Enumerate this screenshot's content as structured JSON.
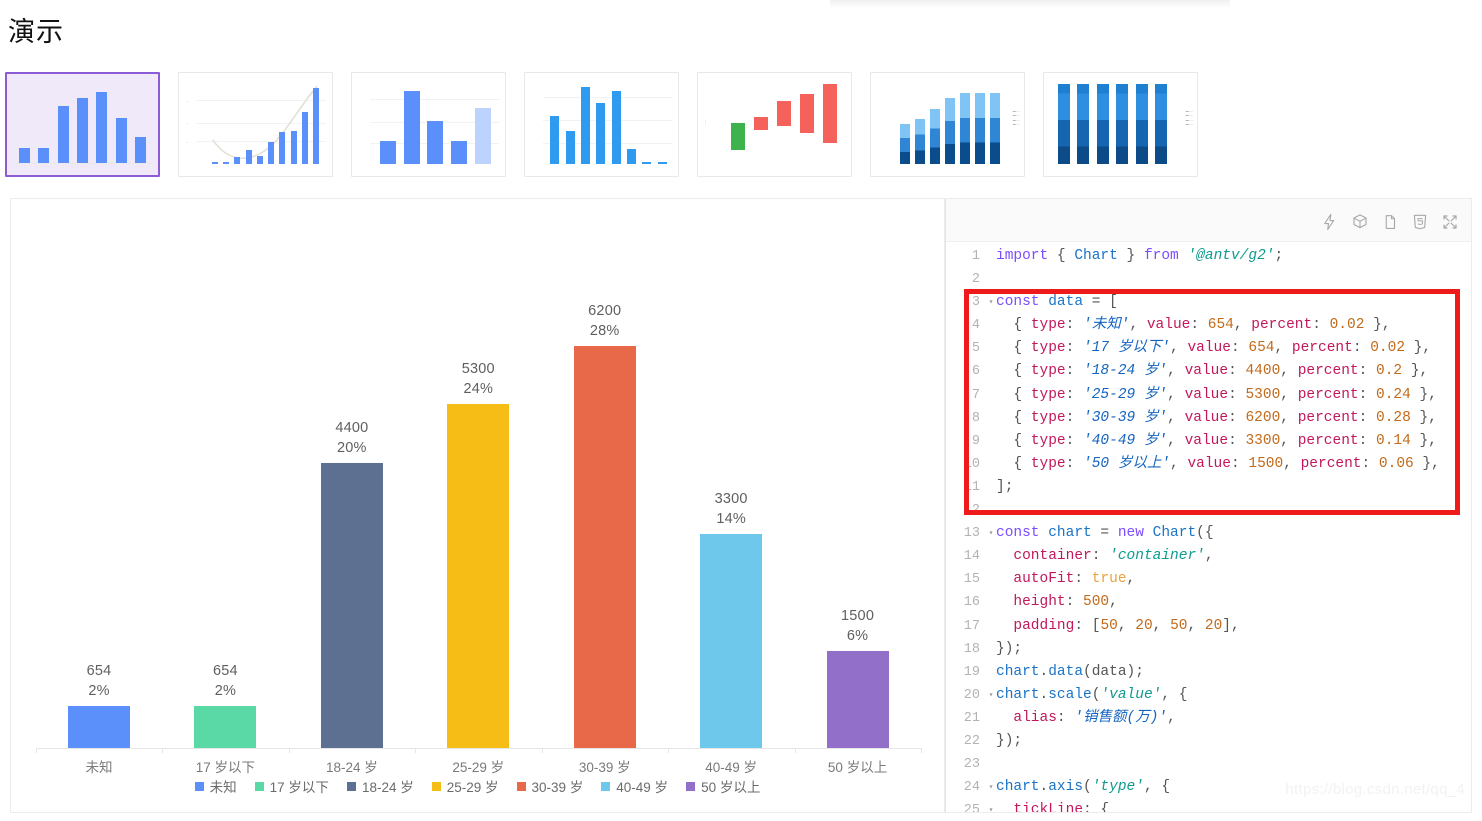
{
  "header": {
    "title": "演示"
  },
  "thumbnails": [
    {
      "name": "basic-column-chart",
      "selected": true
    },
    {
      "name": "column-with-line-chart",
      "selected": false
    },
    {
      "name": "column-highlight-chart",
      "selected": false
    },
    {
      "name": "grouped-column-chart",
      "selected": false
    },
    {
      "name": "waterfall-chart",
      "selected": false
    },
    {
      "name": "stacked-column-chart",
      "selected": false
    },
    {
      "name": "percent-stacked-column-chart",
      "selected": false
    }
  ],
  "chart_data": {
    "type": "bar",
    "title": "",
    "xlabel": "",
    "ylabel": "销售额(万)",
    "categories": [
      "未知",
      "17 岁以下",
      "18-24 岁",
      "25-29 岁",
      "30-39 岁",
      "40-49 岁",
      "50 岁以上"
    ],
    "values": [
      654,
      654,
      4400,
      5300,
      6200,
      3300,
      1500
    ],
    "percents": [
      "2%",
      "2%",
      "20%",
      "24%",
      "28%",
      "14%",
      "6%"
    ],
    "percent_values": [
      0.02,
      0.02,
      0.2,
      0.24,
      0.28,
      0.14,
      0.06
    ],
    "value_labels": [
      "654",
      "654",
      "4400",
      "5300",
      "6200",
      "3300",
      "1500"
    ],
    "colors": [
      "#5B8FF9",
      "#5AD8A6",
      "#5D7092",
      "#F6BD16",
      "#E8684A",
      "#6DC8EC",
      "#9270CA"
    ],
    "ylim": [
      0,
      6200
    ],
    "grid": false,
    "legend_position": "bottom",
    "legend": [
      "未知",
      "17 岁以下",
      "18-24 岁",
      "25-29 岁",
      "30-39 岁",
      "40-49 岁",
      "50 岁以上"
    ]
  },
  "code_panel": {
    "toolbar": [
      {
        "icon": "lightning-icon"
      },
      {
        "icon": "codesandbox-cube-icon"
      },
      {
        "icon": "copy-file-icon"
      },
      {
        "icon": "html5-badge-icon"
      },
      {
        "icon": "fullscreen-icon"
      }
    ],
    "lines": [
      {
        "n": "1",
        "fold": "",
        "tokens": [
          {
            "t": "import",
            "c": "kw"
          },
          {
            "t": " { ",
            "c": "pl"
          },
          {
            "t": "Chart",
            "c": "var"
          },
          {
            "t": " } ",
            "c": "pl"
          },
          {
            "t": "from",
            "c": "kw"
          },
          {
            "t": " ",
            "c": "pl"
          },
          {
            "t": "'@antv/g2'",
            "c": "str"
          },
          {
            "t": ";",
            "c": "pl"
          }
        ]
      },
      {
        "n": "2",
        "fold": "",
        "tokens": []
      },
      {
        "n": "3",
        "fold": "▾",
        "tokens": [
          {
            "t": "const",
            "c": "kw"
          },
          {
            "t": " ",
            "c": "pl"
          },
          {
            "t": "data",
            "c": "var"
          },
          {
            "t": " = [",
            "c": "pl"
          }
        ]
      },
      {
        "n": "4",
        "fold": "",
        "tokens": [
          {
            "t": "  { ",
            "c": "pl"
          },
          {
            "t": "type",
            "c": "prop"
          },
          {
            "t": ": ",
            "c": "pl"
          },
          {
            "t": "'未知'",
            "c": "strb"
          },
          {
            "t": ", ",
            "c": "pl"
          },
          {
            "t": "value",
            "c": "prop"
          },
          {
            "t": ": ",
            "c": "pl"
          },
          {
            "t": "654",
            "c": "num"
          },
          {
            "t": ", ",
            "c": "pl"
          },
          {
            "t": "percent",
            "c": "prop"
          },
          {
            "t": ": ",
            "c": "pl"
          },
          {
            "t": "0.02",
            "c": "num"
          },
          {
            "t": " },",
            "c": "pl"
          }
        ]
      },
      {
        "n": "5",
        "fold": "",
        "tokens": [
          {
            "t": "  { ",
            "c": "pl"
          },
          {
            "t": "type",
            "c": "prop"
          },
          {
            "t": ": ",
            "c": "pl"
          },
          {
            "t": "'17 岁以下'",
            "c": "strb"
          },
          {
            "t": ", ",
            "c": "pl"
          },
          {
            "t": "value",
            "c": "prop"
          },
          {
            "t": ": ",
            "c": "pl"
          },
          {
            "t": "654",
            "c": "num"
          },
          {
            "t": ", ",
            "c": "pl"
          },
          {
            "t": "percent",
            "c": "prop"
          },
          {
            "t": ": ",
            "c": "pl"
          },
          {
            "t": "0.02",
            "c": "num"
          },
          {
            "t": " },",
            "c": "pl"
          }
        ]
      },
      {
        "n": "6",
        "fold": "",
        "tokens": [
          {
            "t": "  { ",
            "c": "pl"
          },
          {
            "t": "type",
            "c": "prop"
          },
          {
            "t": ": ",
            "c": "pl"
          },
          {
            "t": "'18-24 岁'",
            "c": "strb"
          },
          {
            "t": ", ",
            "c": "pl"
          },
          {
            "t": "value",
            "c": "prop"
          },
          {
            "t": ": ",
            "c": "pl"
          },
          {
            "t": "4400",
            "c": "num"
          },
          {
            "t": ", ",
            "c": "pl"
          },
          {
            "t": "percent",
            "c": "prop"
          },
          {
            "t": ": ",
            "c": "pl"
          },
          {
            "t": "0.2",
            "c": "num"
          },
          {
            "t": " },",
            "c": "pl"
          }
        ]
      },
      {
        "n": "7",
        "fold": "",
        "tokens": [
          {
            "t": "  { ",
            "c": "pl"
          },
          {
            "t": "type",
            "c": "prop"
          },
          {
            "t": ": ",
            "c": "pl"
          },
          {
            "t": "'25-29 岁'",
            "c": "strb"
          },
          {
            "t": ", ",
            "c": "pl"
          },
          {
            "t": "value",
            "c": "prop"
          },
          {
            "t": ": ",
            "c": "pl"
          },
          {
            "t": "5300",
            "c": "num"
          },
          {
            "t": ", ",
            "c": "pl"
          },
          {
            "t": "percent",
            "c": "prop"
          },
          {
            "t": ": ",
            "c": "pl"
          },
          {
            "t": "0.24",
            "c": "num"
          },
          {
            "t": " },",
            "c": "pl"
          }
        ]
      },
      {
        "n": "8",
        "fold": "",
        "tokens": [
          {
            "t": "  { ",
            "c": "pl"
          },
          {
            "t": "type",
            "c": "prop"
          },
          {
            "t": ": ",
            "c": "pl"
          },
          {
            "t": "'30-39 岁'",
            "c": "strb"
          },
          {
            "t": ", ",
            "c": "pl"
          },
          {
            "t": "value",
            "c": "prop"
          },
          {
            "t": ": ",
            "c": "pl"
          },
          {
            "t": "6200",
            "c": "num"
          },
          {
            "t": ", ",
            "c": "pl"
          },
          {
            "t": "percent",
            "c": "prop"
          },
          {
            "t": ": ",
            "c": "pl"
          },
          {
            "t": "0.28",
            "c": "num"
          },
          {
            "t": " },",
            "c": "pl"
          }
        ]
      },
      {
        "n": "9",
        "fold": "",
        "tokens": [
          {
            "t": "  { ",
            "c": "pl"
          },
          {
            "t": "type",
            "c": "prop"
          },
          {
            "t": ": ",
            "c": "pl"
          },
          {
            "t": "'40-49 岁'",
            "c": "strb"
          },
          {
            "t": ", ",
            "c": "pl"
          },
          {
            "t": "value",
            "c": "prop"
          },
          {
            "t": ": ",
            "c": "pl"
          },
          {
            "t": "3300",
            "c": "num"
          },
          {
            "t": ", ",
            "c": "pl"
          },
          {
            "t": "percent",
            "c": "prop"
          },
          {
            "t": ": ",
            "c": "pl"
          },
          {
            "t": "0.14",
            "c": "num"
          },
          {
            "t": " },",
            "c": "pl"
          }
        ]
      },
      {
        "n": "10",
        "fold": "",
        "tokens": [
          {
            "t": "  { ",
            "c": "pl"
          },
          {
            "t": "type",
            "c": "prop"
          },
          {
            "t": ": ",
            "c": "pl"
          },
          {
            "t": "'50 岁以上'",
            "c": "strb"
          },
          {
            "t": ", ",
            "c": "pl"
          },
          {
            "t": "value",
            "c": "prop"
          },
          {
            "t": ": ",
            "c": "pl"
          },
          {
            "t": "1500",
            "c": "num"
          },
          {
            "t": ", ",
            "c": "pl"
          },
          {
            "t": "percent",
            "c": "prop"
          },
          {
            "t": ": ",
            "c": "pl"
          },
          {
            "t": "0.06",
            "c": "num"
          },
          {
            "t": " },",
            "c": "pl"
          }
        ]
      },
      {
        "n": "11",
        "fold": "",
        "tokens": [
          {
            "t": "];",
            "c": "pl"
          }
        ]
      },
      {
        "n": "12",
        "fold": "",
        "tokens": []
      },
      {
        "n": "13",
        "fold": "▾",
        "tokens": [
          {
            "t": "const",
            "c": "kw"
          },
          {
            "t": " ",
            "c": "pl"
          },
          {
            "t": "chart",
            "c": "var"
          },
          {
            "t": " = ",
            "c": "pl"
          },
          {
            "t": "new",
            "c": "kw"
          },
          {
            "t": " ",
            "c": "pl"
          },
          {
            "t": "Chart",
            "c": "var"
          },
          {
            "t": "({",
            "c": "pl"
          }
        ]
      },
      {
        "n": "14",
        "fold": "",
        "tokens": [
          {
            "t": "  ",
            "c": "pl"
          },
          {
            "t": "container",
            "c": "prop"
          },
          {
            "t": ": ",
            "c": "pl"
          },
          {
            "t": "'container'",
            "c": "str"
          },
          {
            "t": ",",
            "c": "pl"
          }
        ]
      },
      {
        "n": "15",
        "fold": "",
        "tokens": [
          {
            "t": "  ",
            "c": "pl"
          },
          {
            "t": "autoFit",
            "c": "prop"
          },
          {
            "t": ": ",
            "c": "pl"
          },
          {
            "t": "true",
            "c": "bool"
          },
          {
            "t": ",",
            "c": "pl"
          }
        ]
      },
      {
        "n": "16",
        "fold": "",
        "tokens": [
          {
            "t": "  ",
            "c": "pl"
          },
          {
            "t": "height",
            "c": "prop"
          },
          {
            "t": ": ",
            "c": "pl"
          },
          {
            "t": "500",
            "c": "num"
          },
          {
            "t": ",",
            "c": "pl"
          }
        ]
      },
      {
        "n": "17",
        "fold": "",
        "tokens": [
          {
            "t": "  ",
            "c": "pl"
          },
          {
            "t": "padding",
            "c": "prop"
          },
          {
            "t": ": [",
            "c": "pl"
          },
          {
            "t": "50",
            "c": "num"
          },
          {
            "t": ", ",
            "c": "pl"
          },
          {
            "t": "20",
            "c": "num"
          },
          {
            "t": ", ",
            "c": "pl"
          },
          {
            "t": "50",
            "c": "num"
          },
          {
            "t": ", ",
            "c": "pl"
          },
          {
            "t": "20",
            "c": "num"
          },
          {
            "t": "],",
            "c": "pl"
          }
        ]
      },
      {
        "n": "18",
        "fold": "",
        "tokens": [
          {
            "t": "});",
            "c": "pl"
          }
        ]
      },
      {
        "n": "19",
        "fold": "",
        "tokens": [
          {
            "t": "chart",
            "c": "var"
          },
          {
            "t": ".",
            "c": "pl"
          },
          {
            "t": "data",
            "c": "fn"
          },
          {
            "t": "(",
            "c": "pl"
          },
          {
            "t": "data",
            "c": "pl"
          },
          {
            "t": ");",
            "c": "pl"
          }
        ]
      },
      {
        "n": "20",
        "fold": "▾",
        "tokens": [
          {
            "t": "chart",
            "c": "var"
          },
          {
            "t": ".",
            "c": "pl"
          },
          {
            "t": "scale",
            "c": "fn"
          },
          {
            "t": "(",
            "c": "pl"
          },
          {
            "t": "'value'",
            "c": "str"
          },
          {
            "t": ", {",
            "c": "pl"
          }
        ]
      },
      {
        "n": "21",
        "fold": "",
        "tokens": [
          {
            "t": "  ",
            "c": "pl"
          },
          {
            "t": "alias",
            "c": "prop"
          },
          {
            "t": ": ",
            "c": "pl"
          },
          {
            "t": "'销售额(万)'",
            "c": "strb"
          },
          {
            "t": ",",
            "c": "pl"
          }
        ]
      },
      {
        "n": "22",
        "fold": "",
        "tokens": [
          {
            "t": "});",
            "c": "pl"
          }
        ]
      },
      {
        "n": "23",
        "fold": "",
        "tokens": []
      },
      {
        "n": "24",
        "fold": "▾",
        "tokens": [
          {
            "t": "chart",
            "c": "var"
          },
          {
            "t": ".",
            "c": "pl"
          },
          {
            "t": "axis",
            "c": "fn"
          },
          {
            "t": "(",
            "c": "pl"
          },
          {
            "t": "'type'",
            "c": "str"
          },
          {
            "t": ", {",
            "c": "pl"
          }
        ]
      },
      {
        "n": "25",
        "fold": "▾",
        "tokens": [
          {
            "t": "  ",
            "c": "pl"
          },
          {
            "t": "tickLine",
            "c": "prop"
          },
          {
            "t": ": {",
            "c": "pl"
          }
        ]
      }
    ]
  },
  "watermark": "https://blog.csdn.net/qq_4"
}
